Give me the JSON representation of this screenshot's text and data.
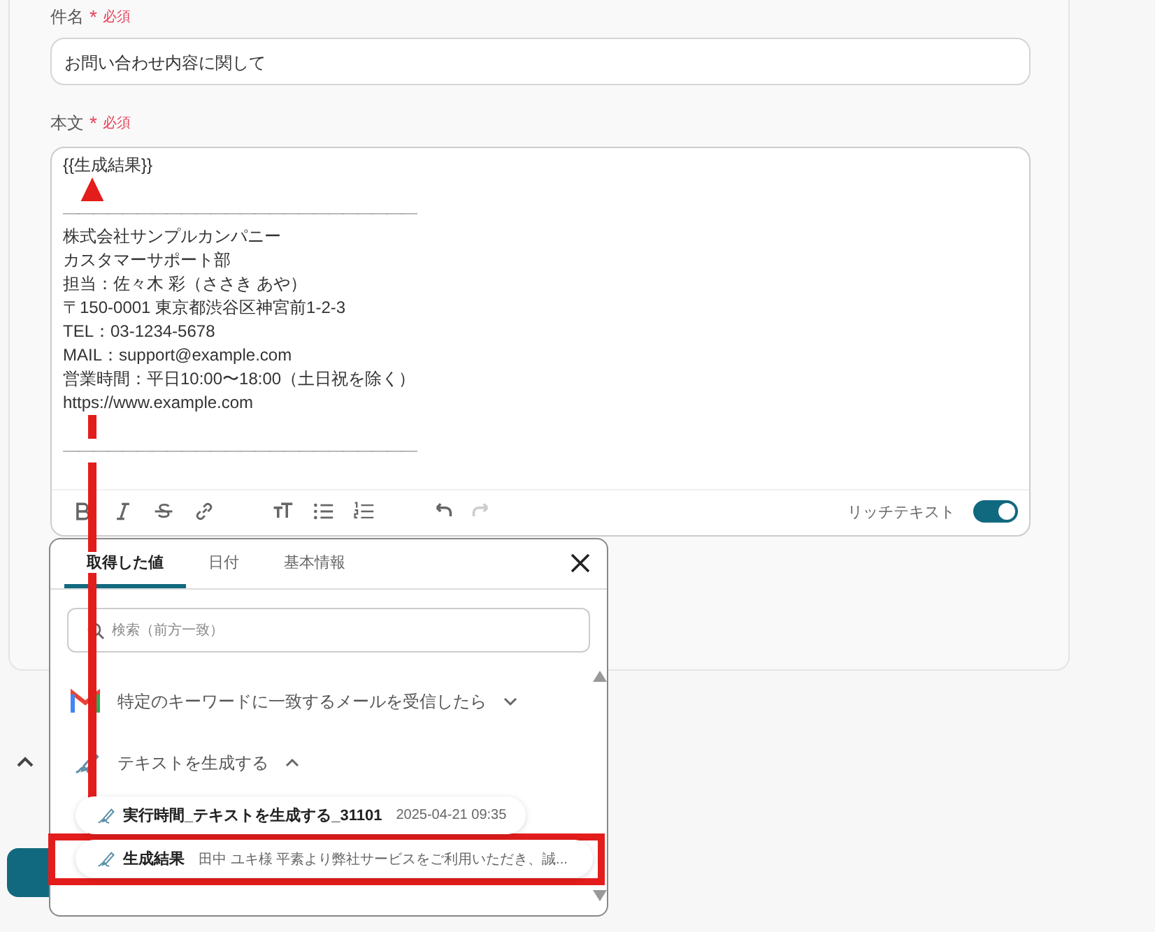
{
  "form": {
    "fields": [
      {
        "label": "件名",
        "required_mark": "*",
        "required_text": "必須",
        "kind": "input",
        "value": "お問い合わせ内容に関して"
      },
      {
        "label": "本文",
        "required_mark": "*",
        "required_text": "必須",
        "kind": "editor",
        "lines": [
          {
            "kind": "text",
            "text": "{{生成結果}}"
          },
          {
            "kind": "separator",
            "text": "――――――――――――――――――――――――"
          },
          {
            "kind": "text",
            "text": "株式会社サンプルカンパニー"
          },
          {
            "kind": "text",
            "text": "カスタマーサポート部"
          },
          {
            "kind": "text",
            "text": "担当：佐々木 彩（ささき あや）"
          },
          {
            "kind": "text",
            "text": "〒150-0001 東京都渋谷区神宮前1-2-3"
          },
          {
            "kind": "text",
            "text": "TEL：03-1234-5678"
          },
          {
            "kind": "text",
            "text": "MAIL：support@example.com"
          },
          {
            "kind": "text",
            "text": "営業時間：平日10:00〜18:00（土日祝を除く）"
          },
          {
            "kind": "text",
            "text": "https://www.example.com"
          },
          {
            "kind": "separator",
            "text": "――――――――――――――――――――――――"
          }
        ],
        "toolbar": [
          {
            "kind": "bold",
            "disabled": false
          },
          {
            "kind": "italic",
            "disabled": false
          },
          {
            "kind": "strike",
            "disabled": false
          },
          {
            "kind": "link",
            "disabled": false
          },
          {
            "kind": "size",
            "disabled": false
          },
          {
            "kind": "bullets",
            "disabled": false
          },
          {
            "kind": "numbers",
            "disabled": false
          },
          {
            "kind": "undo",
            "disabled": false
          },
          {
            "kind": "redo",
            "disabled": true
          }
        ],
        "rich_text": {
          "label": "リッチテキスト",
          "on": true
        }
      }
    ]
  },
  "popup": {
    "tabs": [
      {
        "label": "取得した値",
        "selected": true
      },
      {
        "label": "日付",
        "selected": false
      },
      {
        "label": "基本情報",
        "selected": false
      }
    ],
    "search": {
      "placeholder": "検索（前方一致）"
    },
    "groups": [
      {
        "kind": "mail",
        "title": "特定のキーワードに一致するメールを受信したら",
        "expanded": false
      },
      {
        "kind": "ai",
        "title": "テキストを生成する",
        "expanded": true,
        "children": [
          {
            "name": "実行時間_テキストを生成する_31101",
            "value": "2025-04-21 09:35",
            "highlighted": false
          },
          {
            "name": "生成結果",
            "value": "田中 ユキ様 平素より弊社サービスをご利用いただき、誠...",
            "highlighted": true
          }
        ]
      }
    ]
  }
}
